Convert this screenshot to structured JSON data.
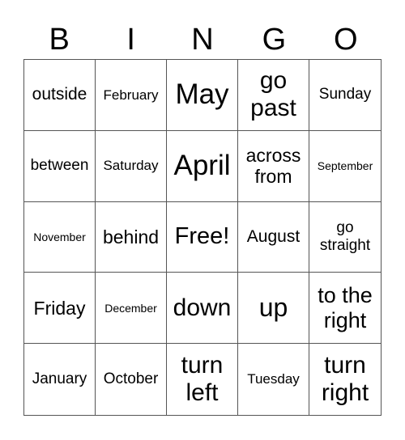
{
  "card": {
    "header": [
      "B",
      "I",
      "N",
      "G",
      "O"
    ],
    "rows": [
      [
        "outside",
        "February",
        "May",
        "go past",
        "Sunday"
      ],
      [
        "between",
        "Saturday",
        "April",
        "across from",
        "September"
      ],
      [
        "November",
        "behind",
        "Free!",
        "August",
        "go straight"
      ],
      [
        "Friday",
        "December",
        "down",
        "up",
        "to the right"
      ],
      [
        "January",
        "October",
        "turn left",
        "Tuesday",
        "turn right"
      ]
    ]
  }
}
